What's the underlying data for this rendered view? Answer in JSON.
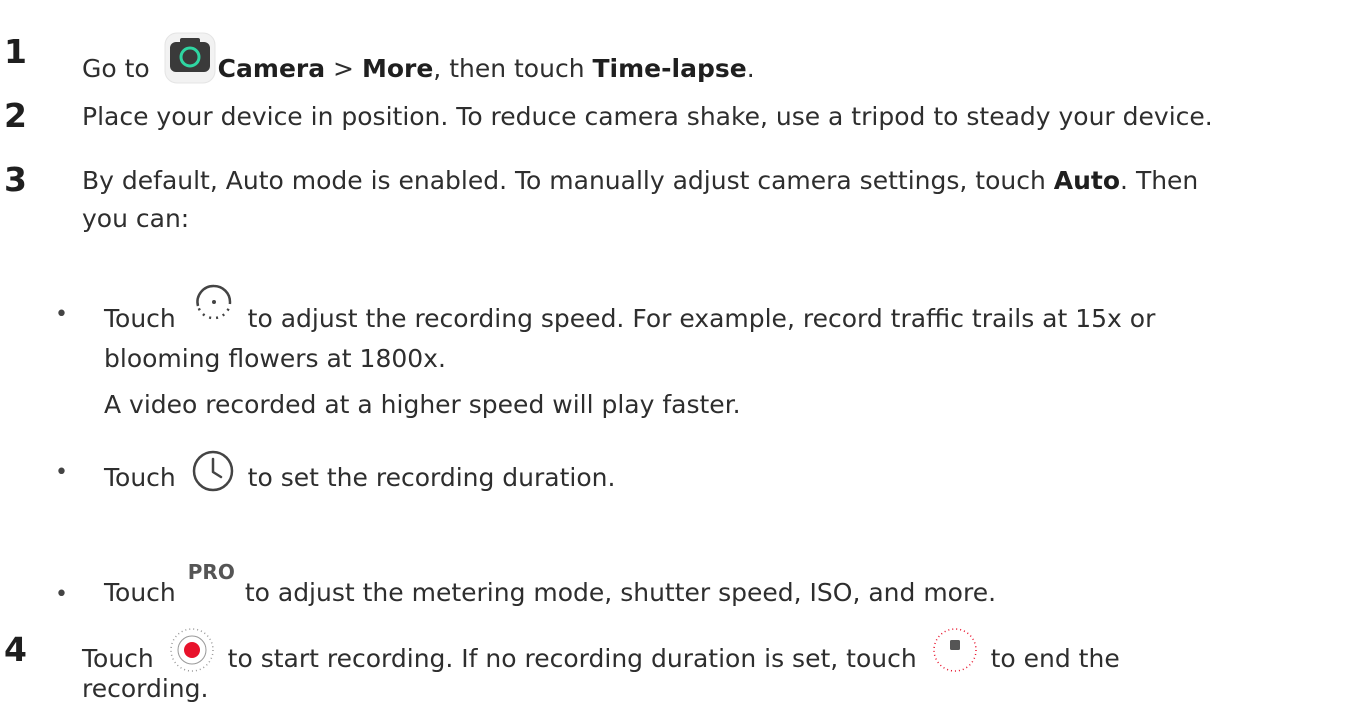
{
  "steps": [
    {
      "number": "1",
      "before": "Go to",
      "camera": "Camera",
      "sep": ">",
      "more": "More",
      "mid": ", then touch",
      "timelapse": "Time-lapse",
      "end": "."
    },
    {
      "number": "2",
      "text": "Place your device in position. To reduce camera shake, use a tripod to steady your device."
    },
    {
      "number": "3",
      "line1_before": "By default, Auto mode is enabled. To manually adjust camera settings, touch",
      "auto": "Auto",
      "line1_after": ". Then",
      "line2": "you can:"
    },
    {
      "number": "4",
      "before": "Touch",
      "middle": "to start recording. If no recording duration is set, touch",
      "after": "to end the",
      "line2": "recording."
    }
  ],
  "bullets": [
    {
      "touch": "Touch",
      "line1": "to adjust the recording speed. For example, record traffic trails at 15x or",
      "line2": "blooming flowers at 1800x.",
      "line3": "A video recorded at a higher speed will play faster."
    },
    {
      "touch": "Touch",
      "line1": "to set the recording duration."
    },
    {
      "touch": "Touch",
      "icon_label": "PRO",
      "line1": "to adjust the metering mode, shutter speed, ISO, and more."
    }
  ],
  "bullet_char": "•",
  "icons": {
    "camera_app": "camera-app-icon",
    "speed": "recording-speed-icon",
    "duration": "clock-icon",
    "pro": "pro-icon",
    "record": "record-icon",
    "stop": "stop-icon"
  },
  "colors": {
    "camera_icon_bg": "#3a3a3a",
    "camera_icon_ring": "#2fd6a2",
    "record_red": "#e8122b"
  }
}
